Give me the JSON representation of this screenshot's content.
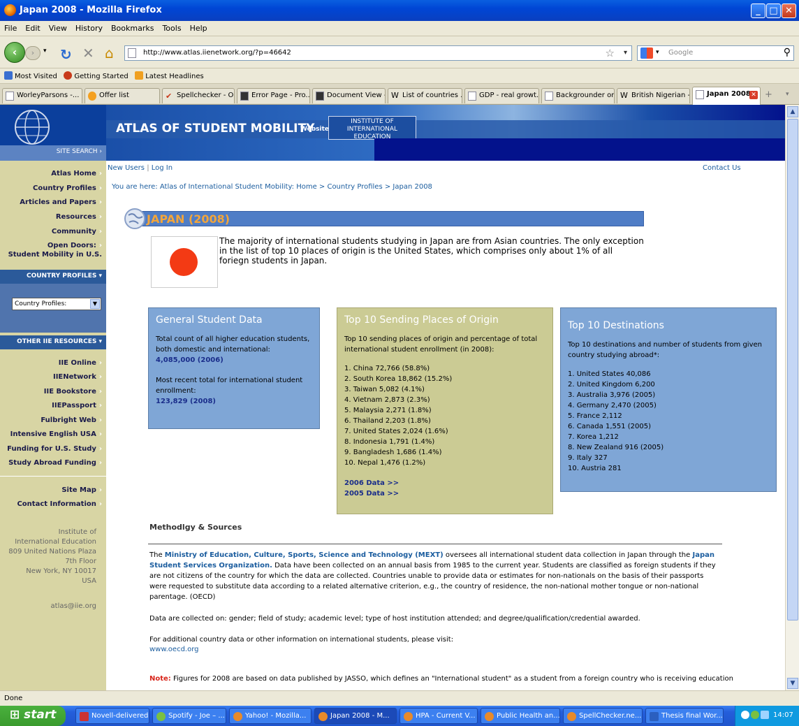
{
  "window": {
    "title": "Japan 2008 - Mozilla Firefox"
  },
  "menu": [
    "File",
    "Edit",
    "View",
    "History",
    "Bookmarks",
    "Tools",
    "Help"
  ],
  "nav": {
    "url": "http://www.atlas.iienetwork.org/?p=46642",
    "search_placeholder": "Google"
  },
  "bookmarks": [
    "Most Visited",
    "Getting Started",
    "Latest Headlines"
  ],
  "tabs": [
    "WorleyParsons -...",
    "Offer list",
    "Spellchecker - O...",
    "Error Page - Pro...",
    "Document View -...",
    "List of countries ...",
    "GDP - real growt...",
    "Backgrounder on...",
    "British Nigerian - ...",
    "Japan 2008"
  ],
  "header": {
    "site_title": "ATLAS OF STUDENT MOBILITY",
    "website_of": "Website of the",
    "iie_logo": "INSTITUTE OF INTERNATIONAL EDUCATION"
  },
  "sidebar": {
    "site_search": "SITE SEARCH",
    "nav": [
      "Atlas Home",
      "Country Profiles",
      "Articles and Papers",
      "Resources",
      "Community",
      "Open Doors:",
      "Student Mobility in U.S."
    ],
    "country_profiles_head": "COUNTRY PROFILES",
    "country_select": "Country Profiles:",
    "other_head": "OTHER IIE RESOURCES",
    "other": [
      "IIE Online",
      "IIENetwork",
      "IIE Bookstore",
      "IIEPassport",
      "Fulbright Web",
      "Intensive English USA",
      "Funding for U.S. Study",
      "Study Abroad Funding"
    ],
    "bottom": [
      "Site Map",
      "Contact Information"
    ],
    "address": [
      "Institute of",
      "International Education",
      "809 United Nations Plaza",
      "7th Floor",
      "New York, NY 10017",
      "USA"
    ],
    "email": "atlas@iie.org"
  },
  "topnav": {
    "new_users": "New Users",
    "sep": "|",
    "login": "Log In",
    "contact": "Contact Us"
  },
  "breadcrumb": {
    "prefix": "You are here:",
    "path": "Atlas of International Student Mobility: Home > Country Profiles > Japan 2008"
  },
  "page_title": "JAPAN (2008)",
  "intro": "The majority of international students studying in Japan are from Asian countries. The only exception in the list of top 10 places of origin is the United States, which comprises only about 1% of all foriegn students in Japan.",
  "general": {
    "title": "General Student Data",
    "total_label": "Total count of all higher education students, both domestic and international:",
    "total_value": "4,085,000 (2006)",
    "intl_label": "Most recent total for international student enrollment:",
    "intl_value": "123,829 (2008)"
  },
  "origin": {
    "title": "Top 10 Sending Places of Origin",
    "desc": "Top 10 sending places of origin and percentage of total international student enrollment (in 2008):",
    "items": [
      "1. China 72,766 (58.8%)",
      "2. South Korea 18,862 (15.2%)",
      "3. Taiwan 5,082 (4.1%)",
      "4. Vietnam 2,873 (2.3%)",
      "5. Malaysia 2,271 (1.8%)",
      "6. Thailand 2,203 (1.8%)",
      "7. United States 2,024 (1.6%)",
      "8. Indonesia 1,791 (1.4%)",
      "9. Bangladesh 1,686 (1.4%)",
      "10. Nepal 1,476 (1.2%)"
    ],
    "link2006": "2006 Data >>",
    "link2005": "2005 Data >>"
  },
  "dest": {
    "title": "Top 10 Destinations",
    "desc": "Top 10 destinations and number of students from given country studying abroad*:",
    "items": [
      "1. United States 40,086",
      "2. United Kingdom 6,200",
      "3. Australia 3,976 (2005)",
      "4. Germany 2,470 (2005)",
      "5. France 2,112",
      "6. Canada 1,551 (2005)",
      "7. Korea 1,212",
      "8. New Zealand 916 (2005)",
      "9. Italy 327",
      "10.  Austria 281"
    ]
  },
  "methodology": {
    "title": "Methodlgy & Sources",
    "p1_pre": "The",
    "p1_link1": "Ministry of Education, Culture, Sports, Science and Technology (MEXT)",
    "p1_mid": "oversees all international student data collection in Japan through the",
    "p1_link2": "Japan Student Services Organization.",
    "p1_post": "Data have been collected on an annual basis from 1985 to the current year. Students are classified as foreign students if they are not citizens of the country for which the data are collected. Countries unable to provide data or estimates for non-nationals on the basis of their passports were requested to substitute data according to a related alternative criterion, e.g., the country of residence, the non-national mother tongue or non-national parentage. (OECD)",
    "p2": "Data are collected on: gender; field of study; academic level; type of host institution attended; and degree/qualification/credential awarded.",
    "p3": "For additional country data or other information on international students, please visit:",
    "p3_link": "www.oecd.org",
    "note_label": "Note:",
    "note_text": "Figures for 2008 are based on data published by JASSO, which defines an \"International student\" as a student from a foreign country who is receiving education"
  },
  "status": "Done",
  "taskbar": {
    "start": "start",
    "items": [
      "Novell-delivered...",
      "Spotify - Joe – ...",
      "Yahoo! - Mozilla...",
      "Japan 2008 - M...",
      "HPA - Current V...",
      "Public Health an...",
      "SpellChecker.ne...",
      "Thesis final Wor..."
    ],
    "clock": "14:07"
  }
}
